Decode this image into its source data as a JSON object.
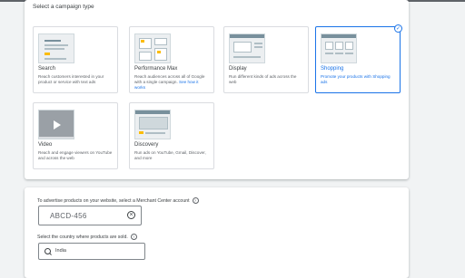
{
  "campaign_type": {
    "heading": "Select a campaign type",
    "options": [
      {
        "title": "Search",
        "desc": "Reach customers interested in your product or service with text ads",
        "selected": false,
        "icon": "search-ad-preview"
      },
      {
        "title": "Performance Max",
        "desc": "Reach audiences across all of Google with a single campaign.",
        "link": "See how it works",
        "selected": false,
        "icon": "performance-max-preview"
      },
      {
        "title": "Display",
        "desc": "Run different kinds of ads across the web",
        "selected": false,
        "icon": "display-ad-preview"
      },
      {
        "title": "Shopping",
        "desc": "Promote your products with Shopping ads",
        "selected": true,
        "icon": "shopping-ad-preview",
        "check_glyph": "✓"
      },
      {
        "title": "Video",
        "desc": "Reach and engage viewers on YouTube and across the web",
        "selected": false,
        "icon": "video-ad-preview"
      },
      {
        "title": "Discovery",
        "desc": "Run ads on YouTube, Gmail, Discover, and more",
        "selected": false,
        "icon": "discovery-ad-preview"
      }
    ]
  },
  "merchant_center": {
    "label": "To advertise products on your website, select a Merchant Center account",
    "help_glyph": "?",
    "value": "ABCD-456",
    "clear_glyph": "×"
  },
  "country": {
    "label": "Select the country where products are sold.",
    "help_glyph": "?",
    "value": "India"
  },
  "colors": {
    "accent": "#1a73e8",
    "background": "#f1f3f4",
    "card": "#ffffff",
    "thumb_yellow": "#fbbc04"
  }
}
